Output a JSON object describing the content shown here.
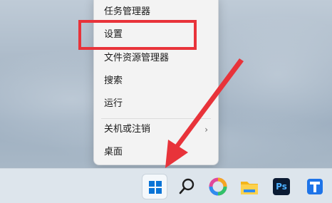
{
  "context_menu": {
    "items": [
      {
        "label": "任务管理器"
      },
      {
        "label": "设置"
      },
      {
        "label": "文件资源管理器"
      },
      {
        "label": "搜索"
      },
      {
        "label": "运行"
      },
      {
        "label": "关机或注销"
      },
      {
        "label": "桌面"
      }
    ]
  },
  "taskbar": {
    "icons": [
      {
        "name": "start-icon"
      },
      {
        "name": "search-icon"
      },
      {
        "name": "copilot-icon"
      },
      {
        "name": "file-explorer-icon"
      },
      {
        "name": "photoshop-icon",
        "text": "Ps"
      },
      {
        "name": "app-icon"
      }
    ]
  },
  "colors": {
    "highlight": "#e8333a",
    "arrow": "#e8333a",
    "start_blue": "#0a74d6"
  }
}
